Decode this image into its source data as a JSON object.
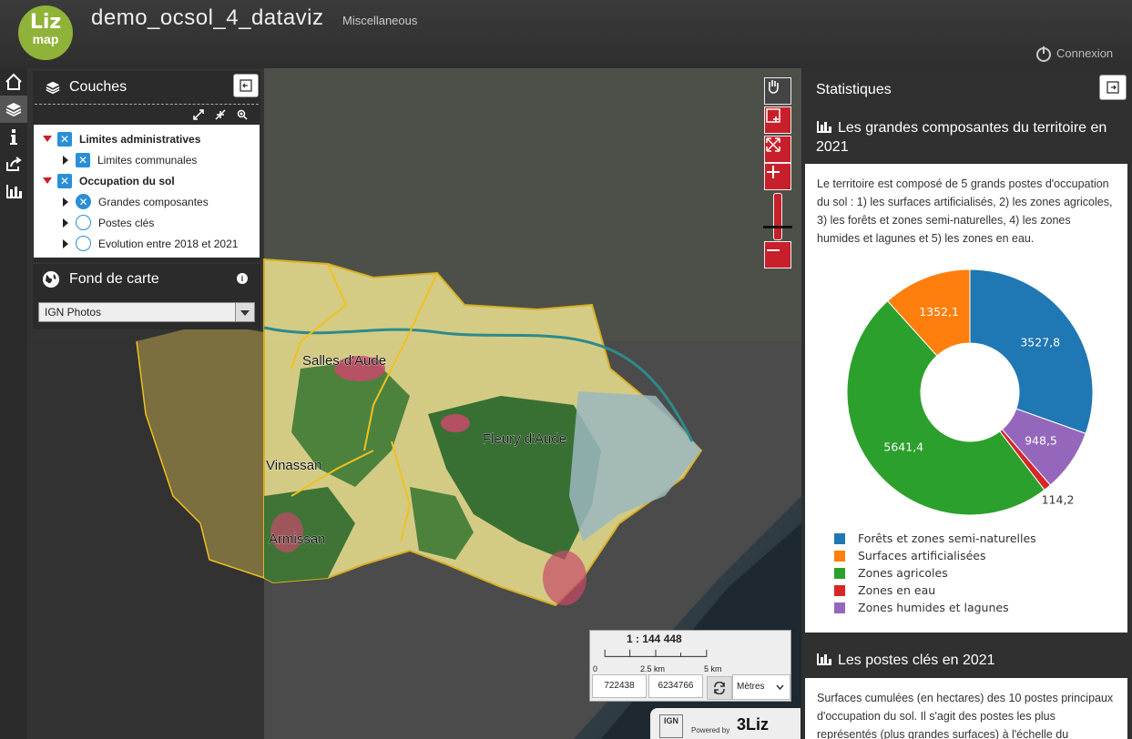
{
  "header": {
    "logo_top": "Liz",
    "logo_bottom": "map",
    "title": "demo_ocsol_4_dataviz",
    "subtitle": "Miscellaneous",
    "login_label": "Connexion"
  },
  "layers_panel": {
    "title": "Couches",
    "tree": [
      {
        "label": "Limites administratives",
        "level": 0,
        "checked": true,
        "bold": true
      },
      {
        "label": "Limites communales",
        "level": 1,
        "checked": true,
        "bold": false
      },
      {
        "label": "Occupation du sol",
        "level": 0,
        "checked": true,
        "bold": true
      },
      {
        "label": "Grandes composantes",
        "level": 1,
        "checked": true,
        "bold": false
      },
      {
        "label": "Postes clés",
        "level": 1,
        "checked": false,
        "bold": false
      },
      {
        "label": "Evolution entre 2018 et 2021",
        "level": 1,
        "checked": false,
        "bold": false
      }
    ]
  },
  "basemap_panel": {
    "title": "Fond de carte",
    "selected": "IGN Photos"
  },
  "map": {
    "place_labels": [
      "Salles-d'Aude",
      "Fleury d'Aude",
      "Vinassan",
      "Armissan"
    ],
    "scale_ratio": "1 : 144 448",
    "scale_ticks": [
      "0",
      "2.5 km",
      "5 km"
    ],
    "coord_x": "722438",
    "coord_y": "6234766",
    "units": "Mètres",
    "attribution_ign": "IGN",
    "attribution_powered": "Powered by",
    "attribution_brand": "3Liz"
  },
  "stats_panel": {
    "title": "Statistiques",
    "section1": {
      "title": "Les grandes composantes du territoire en 2021",
      "text": "Le territoire est composé de 5 grands postes d'occupation du sol : 1) les surfaces artificialisés, 2) les zones agricoles, 3) les forêts et zones semi-naturelles, 4) les zones humides et lagunes et 5) les zones en eau."
    },
    "section2": {
      "title": "Les postes clés en 2021",
      "text": "Surfaces cumulées (en hectares) des 10 postes principaux d'occupation du sol. Il s'agit des postes les plus représentés (plus grandes surfaces) à l'échelle du"
    }
  },
  "chart_data": {
    "type": "pie",
    "donut": true,
    "series": [
      {
        "name": "Forêts et zones semi-naturelles",
        "value": 3527.8,
        "label": "3527,8",
        "color": "#1f77b4"
      },
      {
        "name": "Zones humides et lagunes",
        "value": 948.5,
        "label": "948,5",
        "color": "#9467bd"
      },
      {
        "name": "Zones en eau",
        "value": 114.2,
        "label": "114,2",
        "color": "#d62728"
      },
      {
        "name": "Zones agricoles",
        "value": 5641.4,
        "label": "5641,4",
        "color": "#2ca02c"
      },
      {
        "name": "Surfaces artificialisées",
        "value": 1352.1,
        "label": "1352,1",
        "color": "#ff7f0e"
      }
    ],
    "legend": [
      {
        "name": "Forêts et zones semi-naturelles",
        "color": "#1f77b4"
      },
      {
        "name": "Surfaces artificialisées",
        "color": "#ff7f0e"
      },
      {
        "name": "Zones agricoles",
        "color": "#2ca02c"
      },
      {
        "name": "Zones en eau",
        "color": "#d62728"
      },
      {
        "name": "Zones humides et lagunes",
        "color": "#9467bd"
      }
    ],
    "legend_position": "bottom"
  }
}
